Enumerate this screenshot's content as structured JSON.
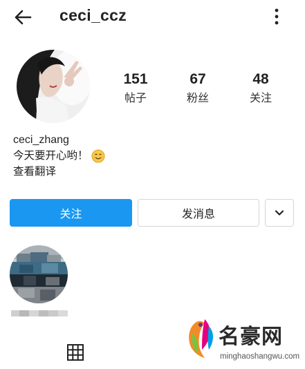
{
  "header": {
    "back_icon": "arrow-left-icon",
    "title": "ceci_ccz",
    "more_icon": "vertical-dots-icon"
  },
  "profile": {
    "stats": [
      {
        "value": "151",
        "label": "帖子"
      },
      {
        "value": "67",
        "label": "粉丝"
      },
      {
        "value": "48",
        "label": "关注"
      }
    ],
    "bio": {
      "name": "ceci_zhang",
      "text": "今天要开心哟！",
      "emoji_icon": "smiling-face-icon",
      "translate": "查看翻译"
    }
  },
  "actions": {
    "follow": "关注",
    "message": "发消息",
    "dropdown_icon": "chevron-down-icon",
    "accent_color": "#1a97f0"
  },
  "tabs": {
    "grid_icon": "grid-icon"
  },
  "watermark": {
    "brand": "名豪网",
    "url": "minghaoshangwu.com"
  }
}
